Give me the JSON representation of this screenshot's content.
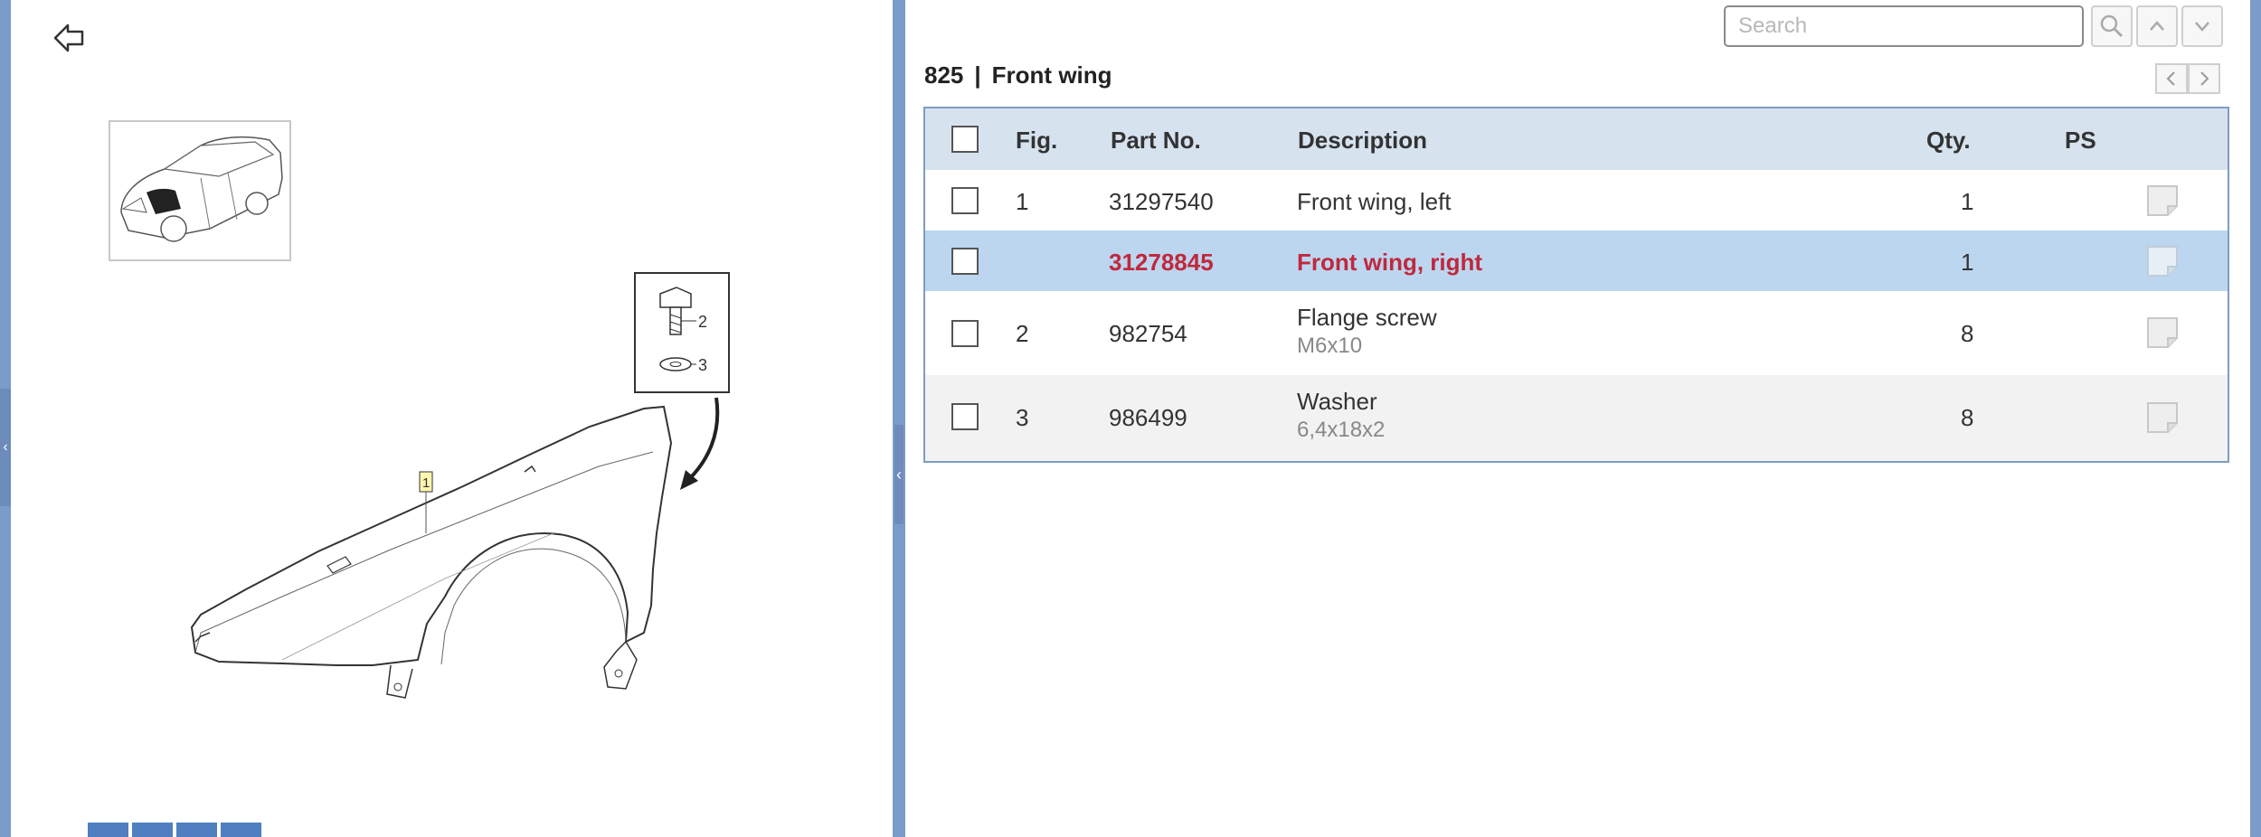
{
  "search": {
    "placeholder": "Search"
  },
  "header": {
    "group_number": "825",
    "separator": "|",
    "title": "Front wing"
  },
  "table": {
    "columns": [
      "Fig.",
      "Part No.",
      "Description",
      "Qty.",
      "PS"
    ],
    "rows": [
      {
        "fig": "1",
        "part_no": "31297540",
        "description": "Front wing, left",
        "sub": "",
        "qty": "1",
        "selected": false
      },
      {
        "fig": "",
        "part_no": "31278845",
        "description": "Front wing, right",
        "sub": "",
        "qty": "1",
        "selected": true
      },
      {
        "fig": "2",
        "part_no": "982754",
        "description": "Flange screw",
        "sub": "M6x10",
        "qty": "8",
        "selected": false
      },
      {
        "fig": "3",
        "part_no": "986499",
        "description": "Washer",
        "sub": "6,4x18x2",
        "qty": "8",
        "selected": false
      }
    ]
  },
  "diagram": {
    "callouts": [
      "1",
      "2",
      "3"
    ]
  },
  "colors": {
    "frame": "#7b9bc8",
    "header_bg": "#d6e3ef",
    "selected_row": "#bcd6f0",
    "selected_text": "#c0283c",
    "row_alt": "#f2f2f2"
  },
  "icons": {
    "back": "back-arrow-icon",
    "search": "search-icon",
    "up": "chevron-up-icon",
    "down": "chevron-down-icon",
    "prev": "chevron-left-icon",
    "next": "chevron-right-icon",
    "ps": "note-icon"
  }
}
